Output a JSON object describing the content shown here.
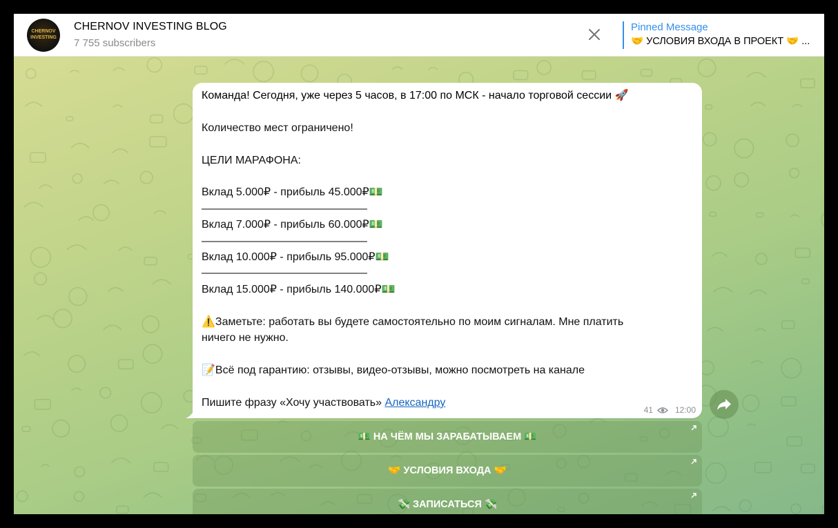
{
  "header": {
    "title": "CHERNOV INVESTING BLOG",
    "subscribers": "7 755 subscribers",
    "avatar_text": "CHERNOV INVESTING",
    "pinned_label": "Pinned Message",
    "pinned_text": "🤝 УСЛОВИЯ ВХОДА В ПРОЕКТ 🤝 ..."
  },
  "message": {
    "lines": [
      "Команда! Сегодня, уже через 5 часов, в 17:00 по МСК - начало торговой сессии 🚀",
      "",
      "Количество мест ограничено!",
      "",
      "ЦЕЛИ МАРАФОНА:",
      "",
      "Вклад 5.000₽ - прибыль 45.000₽💵",
      "———————————————",
      "Вклад 7.000₽ - прибыль 60.000₽💵",
      "———————————————",
      "Вклад 10.000₽ - прибыль 95.000₽💵",
      "———————————————",
      "Вклад 15.000₽ - прибыль 140.000₽💵",
      "",
      "⚠️Заметьте: работать вы будете самостоятельно по моим сигналам. Мне платить",
      "ничего не нужно.",
      "",
      "📝Всё под гарантию: отзывы, видео-отзывы, можно посмотреть на канале",
      ""
    ],
    "last_line_prefix": "Пишите фразу «Хочу участвовать» ",
    "last_line_link": "Александру",
    "views": "41",
    "time": "12:00"
  },
  "buttons": [
    {
      "label": "💵 НА ЧЁМ МЫ ЗАРАБАТЫВАЕМ 💵"
    },
    {
      "label": "🤝 УСЛОВИЯ ВХОДА 🤝"
    },
    {
      "label": "💸 ЗАПИСАТЬСЯ 💸"
    }
  ],
  "colors": {
    "accent": "#3390ec",
    "link": "#1565c0",
    "bubble": "#ffffff"
  },
  "icons": [
    "close-icon",
    "eye-icon",
    "share-icon",
    "external-link-icon"
  ]
}
